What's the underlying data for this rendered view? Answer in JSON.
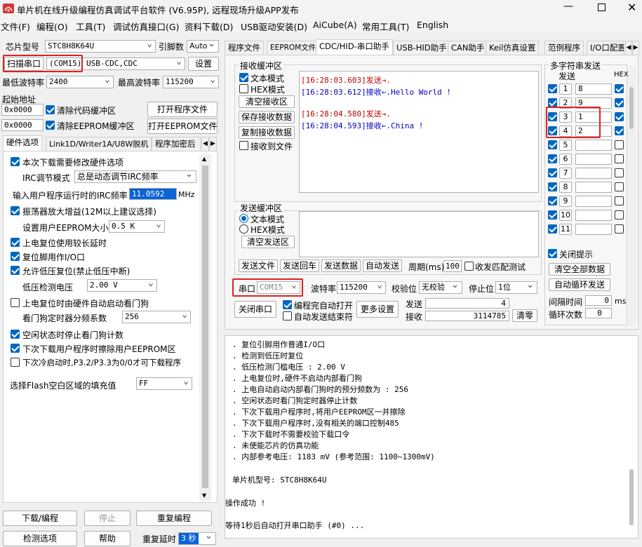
{
  "window": {
    "title": "单片机在线升级编程仿真调试平台软件 (V6.95P), 远程现场升级APP发布"
  },
  "menu": [
    "文件(F)",
    "编程(O)",
    "工具(T)",
    "调试仿真接口(G)",
    "资料下载(D)",
    "USB驱动安装(D)",
    "AiCube(A)",
    "常用工具(T)",
    "English"
  ],
  "left": {
    "chip_label": "芯片型号",
    "chip_value": "STC8H8K64U",
    "pin_label": "引脚数",
    "pin_value": "Auto",
    "scan_label": "扫描串口",
    "port_value": "(COM15) USB-CDC,CDC",
    "settings_btn": "设置",
    "min_baud_label": "最低波特率",
    "min_baud": "2400",
    "max_baud_label": "最高波特率",
    "max_baud": "115200",
    "start_addr_label": "起始地址",
    "addr1": "0x0000",
    "clear_code_label": "清除代码缓冲区",
    "open_prog_btn": "打开程序文件",
    "addr2": "0x0000",
    "clear_eeprom_label": "清除EEPROM缓冲区",
    "open_eeprom_btn": "打开EEPROM文件",
    "tabs": [
      "硬件选项",
      "Link1D/Writer1A/U8W脱机",
      "程序加密后"
    ],
    "options": {
      "opt1": "本次下载需要修改硬件选项",
      "irc_mode_label": "IRC调节模式",
      "irc_mode": "总是动态调节IRC频率",
      "irc_freq_label": "输入用户程序运行时的IRC频率",
      "irc_freq": "11.0592",
      "irc_unit": "MHz",
      "opt2": "振荡器放大增益(12M以上建议选择)",
      "eeprom_size_label": "设置用户EEPROM大小",
      "eeprom_size": "0.5 K",
      "opt3": "上电复位使用较长延时",
      "opt4": "复位脚用作I/O口",
      "opt5": "允许低压复位(禁止低压中断)",
      "lvd_label": "低压检测电压",
      "lvd_value": "2.00 V",
      "opt6": "上电复位时由硬件自动启动看门狗",
      "wdt_label": "看门狗定时器分频系数",
      "wdt_value": "256",
      "opt7": "空闲状态时停止看门狗计数",
      "opt8": "下次下载用户程序时擦除用户EEPROM区",
      "opt9": "下次冷启动时,P3.2/P3.3为0/0才可下载程序",
      "flash_fill_label": "选择Flash空白区域的填充值",
      "flash_fill": "FF"
    },
    "download_btn": "下载/编程",
    "stop_btn": "停止",
    "reprogram_btn": "重复编程",
    "check_btn": "检测选项",
    "help_btn": "帮助",
    "repeat_delay_label": "重复延时",
    "repeat_delay": "3 秒"
  },
  "right": {
    "tabs": [
      "程序文件",
      "EEPROM文件",
      "CDC/HID-串口助手",
      "USB-HID助手",
      "CAN助手",
      "Keil仿真设置",
      "范例程序",
      "I/O口配置"
    ],
    "recv_group": "接收缓冲区",
    "text_mode": "文本模式",
    "hex_mode": "HEX模式",
    "clear_recv": "清空接收区",
    "save_recv": "保存接收数据",
    "copy_recv": "复制接收数据",
    "recv_to_file": "接收到文件",
    "recv_lines": [
      {
        "text": "[16:28:03.603]发送→.",
        "color": "#c00000"
      },
      {
        "text": "[16:28:03.612]接收←.Hello World !",
        "color": "#0000c0"
      },
      {
        "text": "",
        "color": "#000"
      },
      {
        "text": "[16:28:04.580]发送→.",
        "color": "#c00000"
      },
      {
        "text": "[16:28:04.593]接收←.China !",
        "color": "#0000c0"
      }
    ],
    "send_group": "发送缓冲区",
    "send_text_mode": "文本模式",
    "send_hex_mode": "HEX模式",
    "clear_send": "清空发送区",
    "send_file_btn": "发送文件",
    "send_cr_btn": "发送回车",
    "send_data_btn": "发送数据",
    "auto_send_btn": "自动发送",
    "period_label": "周期(ms)",
    "period_value": "100",
    "match_label": "收发匹配测试",
    "port_label": "串口",
    "port_value": "COM15",
    "baud_label": "波特率",
    "baud_value": "115200",
    "parity_label": "校验位",
    "parity_value": "无校验",
    "stop_label": "停止位",
    "stop_value": "1位",
    "close_port_btn": "关闭串口",
    "auto_open_label": "编程完自动打开",
    "auto_end_label": "自动发送结束符",
    "more_settings_btn": "更多设置",
    "send_count_label": "发送",
    "send_count": "4",
    "recv_count_label": "接收",
    "recv_count": "3114785",
    "clear_count_btn": "清零",
    "multi_group": "多字符串发送",
    "multi_send_label": "发送",
    "multi_hex_label": "HEX",
    "multi_rows": [
      {
        "n": "1",
        "v": "8"
      },
      {
        "n": "2",
        "v": "9"
      },
      {
        "n": "3",
        "v": "1"
      },
      {
        "n": "4",
        "v": "2"
      },
      {
        "n": "5",
        "v": ""
      },
      {
        "n": "6",
        "v": ""
      },
      {
        "n": "7",
        "v": ""
      },
      {
        "n": "8",
        "v": ""
      },
      {
        "n": "9",
        "v": ""
      },
      {
        "n": "10",
        "v": ""
      },
      {
        "n": "11",
        "v": ""
      }
    ],
    "close_tip_label": "关闭提示",
    "clear_all_btn": "清空全部数据",
    "auto_loop_btn": "自动循环发送",
    "interval_label": "间隔时间",
    "interval_value": "0",
    "interval_unit": "ms",
    "loop_count_label": "循环次数",
    "loop_count": "0"
  },
  "log_lines": [
    ". 复位引脚用作普通I/O口",
    ". 检测到低压时复位",
    ". 低压检测门槛电压 : 2.00 V",
    ". 上电复位时,硬件不启动内部看门狗",
    ". 上电自动启动内部看门狗时的预分频数为 : 256",
    ". 空闲状态时看门狗定时器停止计数",
    ". 下次下载用户程序时,将用户EEPROM区一并擦除",
    ". 下次下载用户程序时,没有相关的端口控制485",
    ". 下次下载时不需要校验下载口令",
    ". 未使能芯片的仿真功能",
    ". 内部参考电压: 1183 mV (参考范围: 1100~1300mV)",
    "",
    "  单片机型号: STC8H8K64U",
    "",
    "操作成功 !",
    "",
    "等待1秒后自动打开串口助手 (#0) ..."
  ]
}
